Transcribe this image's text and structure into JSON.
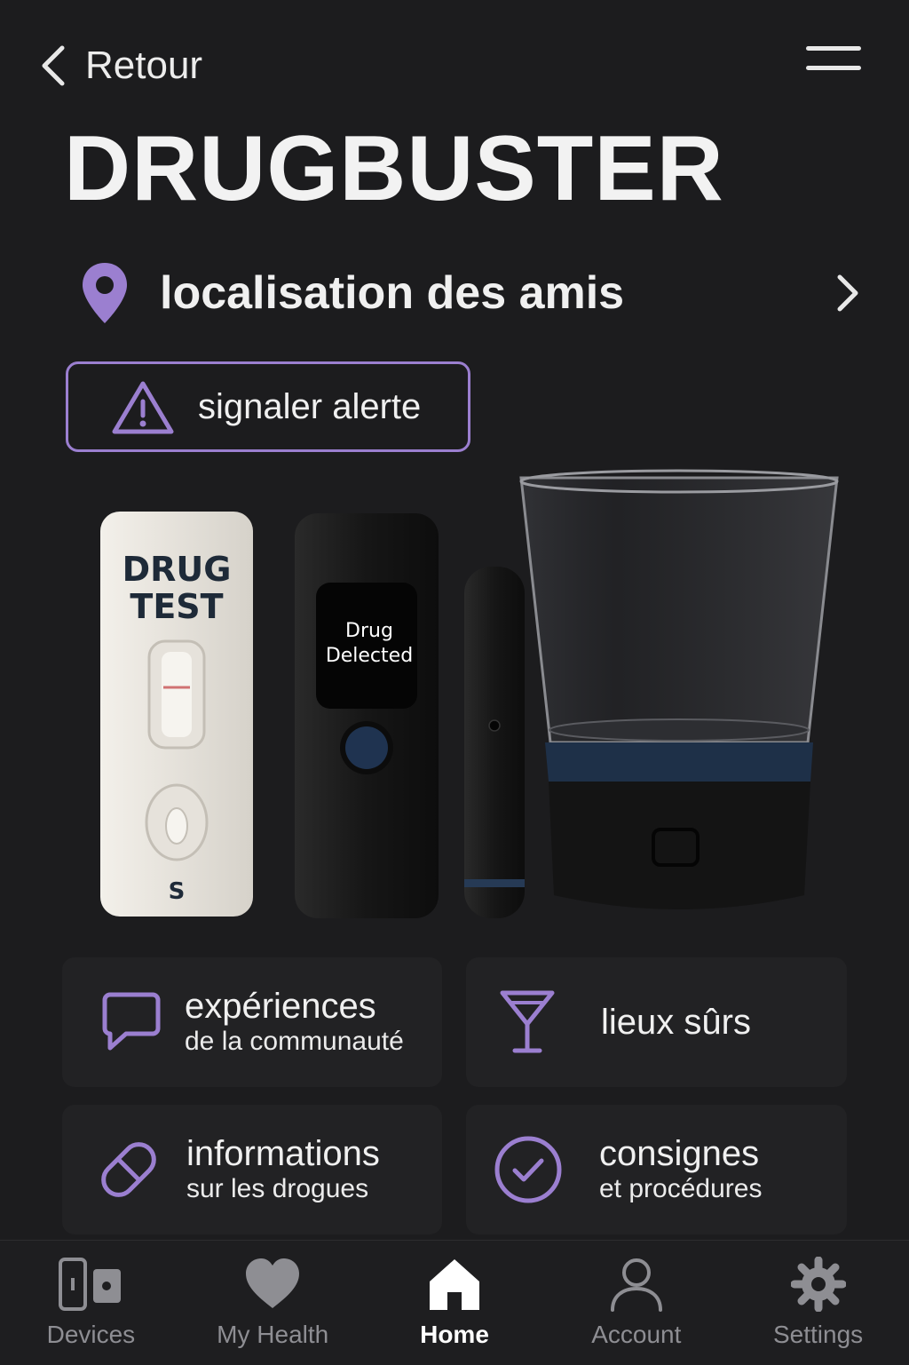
{
  "header": {
    "back_label": "Retour",
    "app_title": "DRUGBUSTER"
  },
  "location": {
    "label": "localisation des amis"
  },
  "alert": {
    "label": "signaler alerte"
  },
  "product": {
    "test_card_line1": "DRUG",
    "test_card_line2": "TEST",
    "test_card_s": "S",
    "device_screen_line1": "Drug",
    "device_screen_line2": "Delected"
  },
  "tiles": [
    {
      "line1": "expériences",
      "line2": "de la communauté",
      "icon": "chat-bubble-icon"
    },
    {
      "line1": "lieux sûrs",
      "line2": "",
      "icon": "wine-glass-icon"
    },
    {
      "line1": "informations",
      "line2": "sur les drogues",
      "icon": "pill-icon"
    },
    {
      "line1": "consignes",
      "line2": "et procédures",
      "icon": "check-circle-icon"
    }
  ],
  "tabs": [
    {
      "label": "Devices",
      "icon": "devices-icon",
      "active": false
    },
    {
      "label": "My Health",
      "icon": "heart-icon",
      "active": false
    },
    {
      "label": "Home",
      "icon": "home-icon",
      "active": true
    },
    {
      "label": "Account",
      "icon": "user-icon",
      "active": false
    },
    {
      "label": "Settings",
      "icon": "gear-icon",
      "active": false
    }
  ],
  "colors": {
    "background": "#1c1c1e",
    "accent": "#9b7fd0",
    "tile": "#222224",
    "text": "#f2f2f2"
  }
}
